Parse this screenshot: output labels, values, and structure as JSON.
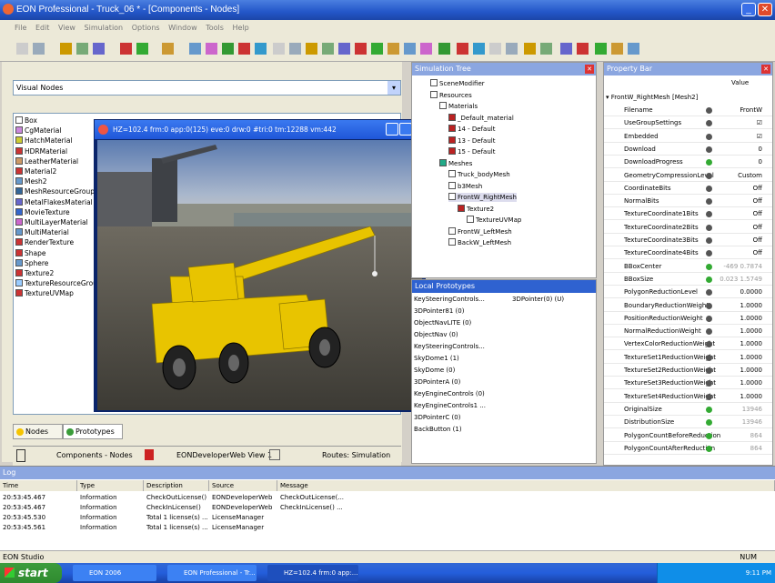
{
  "window": {
    "title": "EON Professional - Truck_06 * - [Components - Nodes]",
    "min": "_",
    "max": "□",
    "close": "✕"
  },
  "menu": [
    "File",
    "Edit",
    "View",
    "Simulation",
    "Options",
    "Window",
    "Tools",
    "Help"
  ],
  "nodes_panel": {
    "combo_value": "Visual Nodes",
    "items": [
      "Box",
      "CgMaterial",
      "HatchMaterial",
      "HDRMaterial",
      "LeatherMaterial",
      "Material2",
      "Mesh2",
      "MeshResourceGroup",
      "MetalFlakesMaterial",
      "MovieTexture",
      "MultiLayerMaterial",
      "MultiMaterial",
      "RenderTexture",
      "Shape",
      "Sphere",
      "Texture2",
      "TextureResourceGroup",
      "TextureUVMap"
    ],
    "tabs": [
      "Nodes",
      "Prototypes"
    ]
  },
  "bottom_tabs": [
    "Components - Nodes",
    "EONDeveloperWeb View 1",
    "Routes: Simulation"
  ],
  "viewer": {
    "title": "HZ=102.4 frm:0 app:0(125) eve:0 drw:0 #tri:0 tm:12288 vm:442"
  },
  "simulation_tree": {
    "title": "Simulation Tree",
    "items": [
      "SceneModifier",
      "Resources",
      "Materials",
      "_Default_material",
      "14 - Default",
      "13 - Default",
      "15 - Default",
      "Meshes",
      "Truck_bodyMesh",
      "b3Mesh",
      "FrontW_RightMesh",
      "Texture2",
      "TextureUVMap",
      "FrontW_LeftMesh",
      "BackW_LeftMesh"
    ]
  },
  "prototypes": {
    "title": "Local Prototypes",
    "items": [
      "KeySteeringControls...",
      "3DPointer(0) (U)",
      "3DPointer81 (0)",
      "ObjectNavLITE (0)",
      "ObjectNav (0)",
      "KeySteeringControls...",
      "SkyDome1 (1)",
      "SkyDome (0)",
      "3DPointerA (0)",
      "KeyEngineControls (0)",
      "KeyEngineControls1 ...",
      "3DPointerC (0)",
      "BackButton (1)"
    ]
  },
  "property_bar": {
    "title": "Property Bar",
    "value_header": "Value",
    "node": "FrontW_RightMesh [Mesh2]",
    "rows": [
      {
        "name": "Filename",
        "value": "FrontW"
      },
      {
        "name": "UseGroupSettings",
        "value": "☑"
      },
      {
        "name": "Embedded",
        "value": "☑"
      },
      {
        "name": "Download",
        "value": "0"
      },
      {
        "name": "DownloadProgress",
        "value": "0"
      },
      {
        "name": "GeometryCompressionLevel",
        "value": "Custom"
      },
      {
        "name": "CoordinateBits",
        "value": "Off"
      },
      {
        "name": "NormalBits",
        "value": "Off"
      },
      {
        "name": "TextureCoordinate1Bits",
        "value": "Off"
      },
      {
        "name": "TextureCoordinate2Bits",
        "value": "Off"
      },
      {
        "name": "TextureCoordinate3Bits",
        "value": "Off"
      },
      {
        "name": "TextureCoordinate4Bits",
        "value": "Off"
      },
      {
        "name": "BBoxCenter",
        "value": "-469 0.7874"
      },
      {
        "name": "BBoxSize",
        "value": "0.023 1.5749"
      },
      {
        "name": "PolygonReductionLevel",
        "value": "0.0000"
      },
      {
        "name": "BoundaryReductionWeight",
        "value": "1.0000"
      },
      {
        "name": "PositionReductionWeight",
        "value": "1.0000"
      },
      {
        "name": "NormalReductionWeight",
        "value": "1.0000"
      },
      {
        "name": "VertexColorReductionWeight",
        "value": "1.0000"
      },
      {
        "name": "TextureSet1ReductionWeight",
        "value": "1.0000"
      },
      {
        "name": "TextureSet2ReductionWeight",
        "value": "1.0000"
      },
      {
        "name": "TextureSet3ReductionWeight",
        "value": "1.0000"
      },
      {
        "name": "TextureSet4ReductionWeight",
        "value": "1.0000"
      },
      {
        "name": "OriginalSize",
        "value": "13946"
      },
      {
        "name": "DistributionSize",
        "value": "13946"
      },
      {
        "name": "PolygonCountBeforeReduction",
        "value": "864"
      },
      {
        "name": "PolygonCountAfterReduction",
        "value": "864"
      }
    ]
  },
  "log": {
    "title": "Log",
    "headers": [
      "Time",
      "Type",
      "Description",
      "Source",
      "Message"
    ],
    "rows": [
      [
        "20:53:45.467",
        "Information",
        "CheckOutLicense()",
        "EONDeveloperWeb",
        "CheckOutLicense(..."
      ],
      [
        "20:53:45.467",
        "Information",
        "CheckInLicense()",
        "EONDeveloperWeb",
        "CheckInLicense() ..."
      ],
      [
        "20:53:45.530",
        "Information",
        "Total 1 license(s) ...",
        "LicenseManager",
        ""
      ],
      [
        "20:53:45.561",
        "Information",
        "Total 1 license(s) ...",
        "LicenseManager",
        ""
      ]
    ]
  },
  "status": {
    "left": "EON Studio",
    "right": "NUM"
  },
  "taskbar": {
    "start": "start",
    "tasks": [
      "EON 2006",
      "EON Professional - Tr...",
      "HZ=102.4 frm:0 app:..."
    ],
    "clock": "9:11 PM"
  }
}
